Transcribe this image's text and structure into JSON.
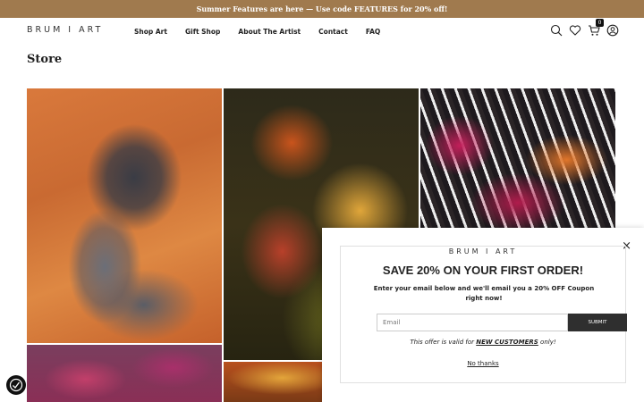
{
  "announcement": {
    "text": "Summer Features are here — Use code FEATURES for 20% off!"
  },
  "header": {
    "logo": "BRUM I ART",
    "nav": [
      "Shop Art",
      "Gift Shop",
      "About The Artist",
      "Contact",
      "FAQ"
    ],
    "icons": [
      "search-icon",
      "heart-icon",
      "cart-icon",
      "account-icon"
    ],
    "cart_count": "0"
  },
  "page": {
    "title": "Store"
  },
  "popup": {
    "brand": "BRUM I ART",
    "close": "×",
    "heading": "SAVE 20% ON YOUR FIRST ORDER!",
    "subheading": "Enter your email below and we'll email you a 20% OFF Coupon right now!",
    "email_placeholder": "Email",
    "submit_label": "SUBMIT",
    "offer_prefix": "This offer is valid for ",
    "offer_bold": "NEW CUSTOMERS",
    "offer_suffix": " only!",
    "no_thanks": "No thanks"
  },
  "colors": {
    "announcement_bg": "#a07a4e",
    "submit_bg": "#2f2f2f"
  }
}
